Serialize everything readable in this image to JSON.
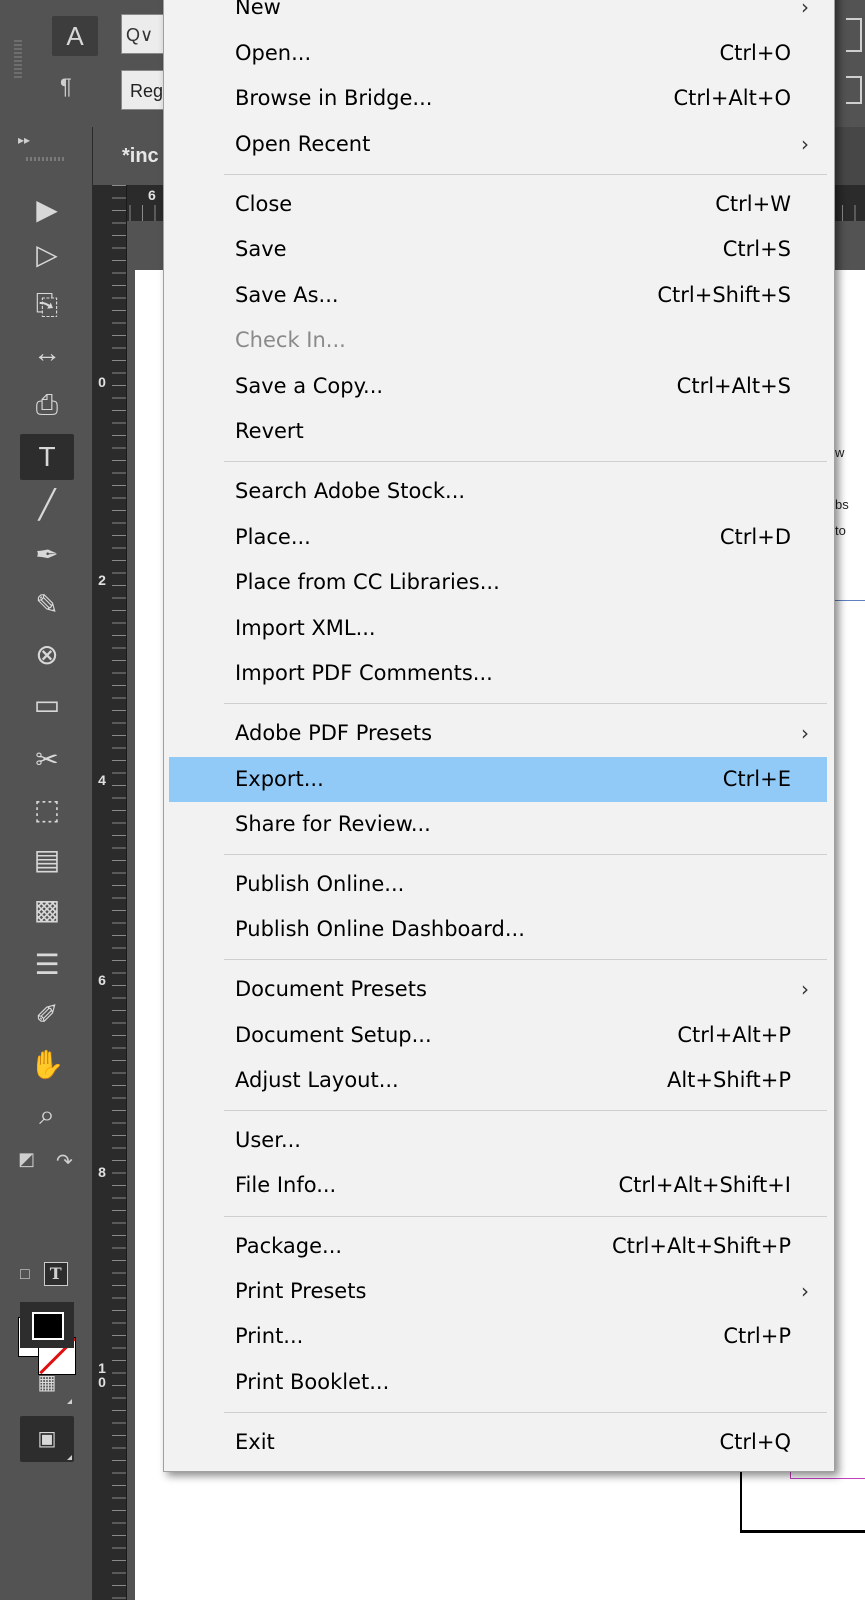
{
  "control_panel": {
    "char_mode_label": "A",
    "para_mode_label": "¶",
    "search_value": "Q∨",
    "font_style_value": "Reg"
  },
  "document_tab": {
    "label": "*inc"
  },
  "rulers": {
    "h_label": "6",
    "v_labels": [
      "0",
      "2",
      "4",
      "6",
      "8",
      "1\n0"
    ]
  },
  "page_text": "w\n\nbs\nto",
  "menu": {
    "items": [
      {
        "label": "New",
        "shortcut": "",
        "submenu": true
      },
      {
        "label": "Open...",
        "shortcut": "Ctrl+O",
        "submenu": false
      },
      {
        "label": "Browse in Bridge...",
        "shortcut": "Ctrl+Alt+O",
        "submenu": false
      },
      {
        "label": "Open Recent",
        "shortcut": "",
        "submenu": true
      },
      {
        "label": "Close",
        "shortcut": "Ctrl+W",
        "submenu": false
      },
      {
        "label": "Save",
        "shortcut": "Ctrl+S",
        "submenu": false
      },
      {
        "label": "Save As...",
        "shortcut": "Ctrl+Shift+S",
        "submenu": false
      },
      {
        "label": "Check In...",
        "shortcut": "",
        "submenu": false,
        "disabled": true
      },
      {
        "label": "Save a Copy...",
        "shortcut": "Ctrl+Alt+S",
        "submenu": false
      },
      {
        "label": "Revert",
        "shortcut": "",
        "submenu": false
      },
      {
        "label": "Search Adobe Stock...",
        "shortcut": "",
        "submenu": false
      },
      {
        "label": "Place...",
        "shortcut": "Ctrl+D",
        "submenu": false
      },
      {
        "label": "Place from CC Libraries...",
        "shortcut": "",
        "submenu": false
      },
      {
        "label": "Import XML...",
        "shortcut": "",
        "submenu": false
      },
      {
        "label": "Import PDF Comments...",
        "shortcut": "",
        "submenu": false
      },
      {
        "label": "Adobe PDF Presets",
        "shortcut": "",
        "submenu": true
      },
      {
        "label": "Export...",
        "shortcut": "Ctrl+E",
        "submenu": false,
        "highlighted": true
      },
      {
        "label": "Share for Review...",
        "shortcut": "",
        "submenu": false
      },
      {
        "label": "Publish Online...",
        "shortcut": "",
        "submenu": false
      },
      {
        "label": "Publish Online Dashboard...",
        "shortcut": "",
        "submenu": false
      },
      {
        "label": "Document Presets",
        "shortcut": "",
        "submenu": true
      },
      {
        "label": "Document Setup...",
        "shortcut": "Ctrl+Alt+P",
        "submenu": false
      },
      {
        "label": "Adjust Layout...",
        "shortcut": "Alt+Shift+P",
        "submenu": false
      },
      {
        "label": "User...",
        "shortcut": "",
        "submenu": false
      },
      {
        "label": "File Info...",
        "shortcut": "Ctrl+Alt+Shift+I",
        "submenu": false
      },
      {
        "label": "Package...",
        "shortcut": "Ctrl+Alt+Shift+P",
        "submenu": false
      },
      {
        "label": "Print Presets",
        "shortcut": "",
        "submenu": true
      },
      {
        "label": "Print...",
        "shortcut": "Ctrl+P",
        "submenu": false
      },
      {
        "label": "Print Booklet...",
        "shortcut": "",
        "submenu": false
      },
      {
        "label": "Exit",
        "shortcut": "Ctrl+Q",
        "submenu": false
      }
    ],
    "submenu_arrow": "›"
  },
  "tools": [
    {
      "name": "selection-tool-icon",
      "glyph": "▶"
    },
    {
      "name": "direct-selection-tool-icon",
      "glyph": "▷"
    },
    {
      "name": "page-tool-icon",
      "glyph": "⎘"
    },
    {
      "name": "gap-tool-icon",
      "glyph": "↔"
    },
    {
      "name": "content-collector-icon",
      "glyph": "⎙"
    },
    {
      "name": "type-tool-icon",
      "glyph": "T"
    },
    {
      "name": "line-tool-icon",
      "glyph": "╱"
    },
    {
      "name": "pen-tool-icon",
      "glyph": "✒"
    },
    {
      "name": "pencil-tool-icon",
      "glyph": "✎"
    },
    {
      "name": "rectangle-frame-tool-icon",
      "glyph": "⊗"
    },
    {
      "name": "rectangle-tool-icon",
      "glyph": "▭"
    },
    {
      "name": "scissors-tool-icon",
      "glyph": "✂"
    },
    {
      "name": "free-transform-tool-icon",
      "glyph": "⬚"
    },
    {
      "name": "gradient-swatch-tool-icon",
      "glyph": "▤"
    },
    {
      "name": "gradient-feather-tool-icon",
      "glyph": "▩"
    },
    {
      "name": "note-tool-icon",
      "glyph": "☰"
    },
    {
      "name": "eyedropper-tool-icon",
      "glyph": "✐"
    },
    {
      "name": "hand-tool-icon",
      "glyph": "✋"
    },
    {
      "name": "zoom-tool-icon",
      "glyph": "⌕"
    }
  ],
  "fill_stroke": {
    "fill_glyph": "T",
    "swap_icon": "↷",
    "default_icon": "◩",
    "format_glyph": "T"
  },
  "colors": {
    "menu_highlight": "#91c9f7",
    "menu_bg": "#f2f2f2",
    "ui_bg": "#535353"
  }
}
